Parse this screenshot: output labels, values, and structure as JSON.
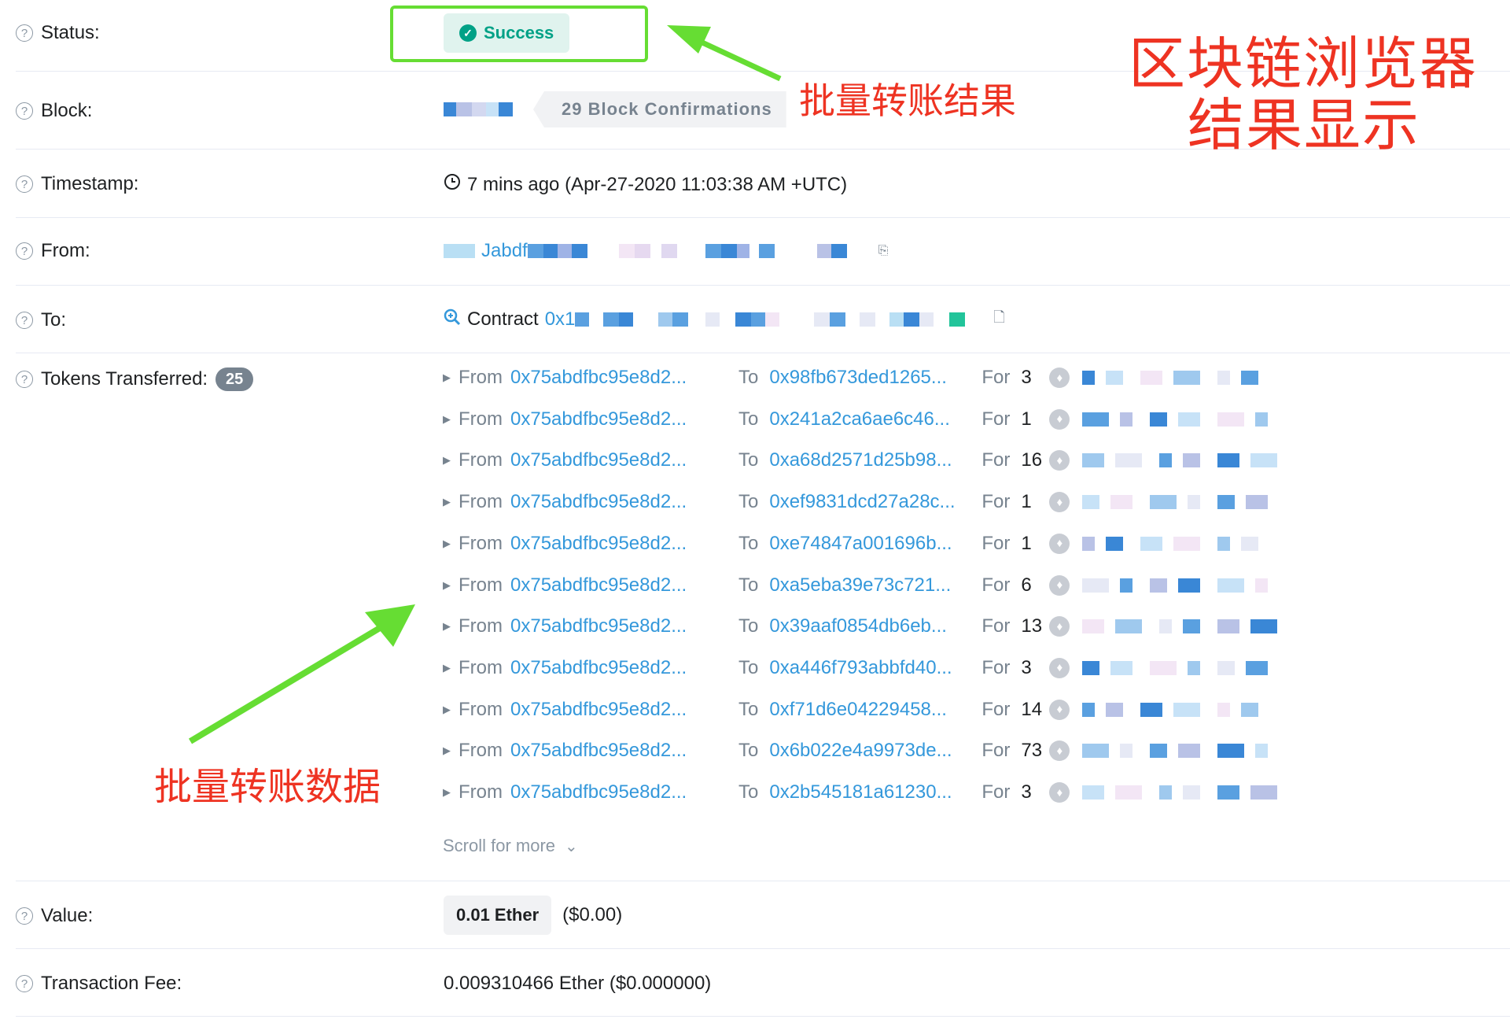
{
  "status": {
    "label": "Status:",
    "badge": "Success"
  },
  "block": {
    "label": "Block:",
    "confirmations": "29 Block Confirmations"
  },
  "timestamp": {
    "label": "Timestamp:",
    "value": "7 mins ago (Apr-27-2020 11:03:38 AM +UTC)"
  },
  "from": {
    "label": "From:",
    "value": "Jabdf"
  },
  "to": {
    "label": "To:",
    "prefix": "Contract",
    "value": "0x1"
  },
  "tokens": {
    "label": "Tokens Transferred:",
    "count": "25",
    "from_word": "From",
    "to_word": "To",
    "for_word": "For",
    "rows": [
      {
        "from": "0x75abdfbc95e8d2...",
        "to": "0x98fb673ded1265...",
        "amount": "3"
      },
      {
        "from": "0x75abdfbc95e8d2...",
        "to": "0x241a2ca6ae6c46...",
        "amount": "1"
      },
      {
        "from": "0x75abdfbc95e8d2...",
        "to": "0xa68d2571d25b98...",
        "amount": "16"
      },
      {
        "from": "0x75abdfbc95e8d2...",
        "to": "0xef9831dcd27a28c...",
        "amount": "1"
      },
      {
        "from": "0x75abdfbc95e8d2...",
        "to": "0xe74847a001696b...",
        "amount": "1"
      },
      {
        "from": "0x75abdfbc95e8d2...",
        "to": "0xa5eba39e73c721...",
        "amount": "6"
      },
      {
        "from": "0x75abdfbc95e8d2...",
        "to": "0x39aaf0854db6eb...",
        "amount": "13"
      },
      {
        "from": "0x75abdfbc95e8d2...",
        "to": "0xa446f793abbfd40...",
        "amount": "3"
      },
      {
        "from": "0x75abdfbc95e8d2...",
        "to": "0xf71d6e04229458...",
        "amount": "14"
      },
      {
        "from": "0x75abdfbc95e8d2...",
        "to": "0x6b022e4a9973de...",
        "amount": "73"
      },
      {
        "from": "0x75abdfbc95e8d2...",
        "to": "0x2b545181a61230...",
        "amount": "3"
      }
    ],
    "scroll_more": "Scroll for more"
  },
  "value": {
    "label": "Value:",
    "ether": "0.01 Ether",
    "usd": "($0.00)"
  },
  "fee": {
    "label": "Transaction Fee:",
    "value": "0.009310466 Ether ($0.000000)"
  },
  "annotations": {
    "title_line1": "区块链浏览器",
    "title_line2": "结果显示",
    "batch_result": "批量转账结果",
    "batch_data": "批量转账数据"
  },
  "colors": {
    "accent": "#3498db",
    "success": "#00a186",
    "annotation_red": "#ee3322",
    "arrow_green": "#66dd33"
  }
}
